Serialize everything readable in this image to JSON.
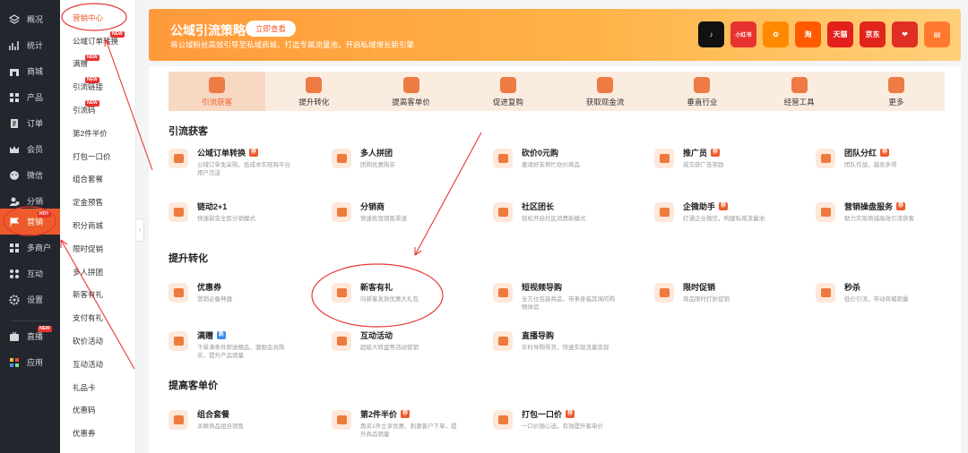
{
  "sidebar": {
    "items": [
      {
        "label": "概况",
        "icon": "layers-icon"
      },
      {
        "label": "统计",
        "icon": "chart-icon"
      },
      {
        "label": "商城",
        "icon": "store-icon"
      },
      {
        "label": "产品",
        "icon": "grid-icon"
      },
      {
        "label": "订单",
        "icon": "order-icon"
      },
      {
        "label": "会员",
        "icon": "crown-icon"
      },
      {
        "label": "微信",
        "icon": "wechat-icon"
      },
      {
        "label": "分销",
        "icon": "users-icon"
      },
      {
        "label": "营销",
        "icon": "flag-icon",
        "badge": "HOT"
      },
      {
        "label": "多商户",
        "icon": "shop-icon"
      },
      {
        "label": "互动",
        "icon": "apps-icon"
      },
      {
        "label": "设置",
        "icon": "gear-icon"
      },
      {
        "label": "直播",
        "icon": "tv-icon",
        "badge": "NEW"
      },
      {
        "label": "应用",
        "icon": "colorful-apps-icon"
      }
    ]
  },
  "subnav": {
    "items": [
      {
        "label": "营销中心"
      },
      {
        "label": "公域订单转换",
        "badge": "NEW"
      },
      {
        "label": "满赠",
        "badge": "NEW"
      },
      {
        "label": "引流链接",
        "badge": "NEW"
      },
      {
        "label": "引流码",
        "badge": "NEW"
      },
      {
        "label": "第2件半价"
      },
      {
        "label": "打包一口价"
      },
      {
        "label": "组合套餐"
      },
      {
        "label": "定金预售"
      },
      {
        "label": "积分商城"
      },
      {
        "label": "限时促销"
      },
      {
        "label": "多人拼团"
      },
      {
        "label": "新客有礼"
      },
      {
        "label": "支付有礼"
      },
      {
        "label": "砍价活动"
      },
      {
        "label": "互动活动"
      },
      {
        "label": "礼品卡"
      },
      {
        "label": "优惠码"
      },
      {
        "label": "优惠券"
      }
    ]
  },
  "banner": {
    "title": "公域引流策略",
    "button": "立即查看",
    "subtitle": "将公域粉丝高效引导至私域商城，打造专属流量池，开启私域增长新引擎",
    "platforms": [
      {
        "name": "抖音",
        "icon": "douyin-icon",
        "glyph": "♪",
        "color": "#111111"
      },
      {
        "name": "小红书",
        "icon": "xiaohongshu-icon",
        "glyph": "小红书",
        "color": "#e8322f"
      },
      {
        "name": "快手",
        "icon": "kuaishou-icon",
        "glyph": "✿",
        "color": "#ff8a00"
      },
      {
        "name": "淘宝",
        "icon": "taobao-icon",
        "glyph": "淘",
        "color": "#ff5a00"
      },
      {
        "name": "天猫",
        "icon": "tmall-icon",
        "glyph": "天猫",
        "color": "#e3201b"
      },
      {
        "name": "京东",
        "icon": "jd-icon",
        "glyph": "京东",
        "color": "#e1251b"
      },
      {
        "name": "拼多多",
        "icon": "pinduoduo-icon",
        "glyph": "❤",
        "color": "#e02e24"
      },
      {
        "name": "商城",
        "icon": "mall-icon",
        "glyph": "▤",
        "color": "#ff7a2e"
      }
    ]
  },
  "tabs": [
    {
      "label": "引流获客",
      "icon": "trend-icon"
    },
    {
      "label": "提升转化",
      "icon": "funnel-icon"
    },
    {
      "label": "提高客单价",
      "icon": "coin-icon"
    },
    {
      "label": "促进复购",
      "icon": "tag-icon"
    },
    {
      "label": "获取现金流",
      "icon": "wallet-icon"
    },
    {
      "label": "垂直行业",
      "icon": "document-icon"
    },
    {
      "label": "经营工具",
      "icon": "bag-icon"
    },
    {
      "label": "更多",
      "icon": "more-icon"
    }
  ],
  "sections": [
    {
      "title": "引流获客",
      "cards": [
        {
          "name": "公域订单转换",
          "tag": "荐",
          "desc": "公域订单免采购，低成本实现跨平台用户沉淀"
        },
        {
          "name": "多人拼团",
          "desc": "团购优惠购买"
        },
        {
          "name": "砍价0元购",
          "desc": "邀请好友帮忙砍价商品"
        },
        {
          "name": "推广员",
          "tag": "荐",
          "desc": "成交获广告奖励"
        },
        {
          "name": "团队分红",
          "tag": "荐",
          "desc": "团队作战，越卖多得"
        },
        {
          "name": "链动2+1",
          "desc": "快速裂变全民分销模式"
        },
        {
          "name": "分销商",
          "desc": "快速拓宽销售渠道"
        },
        {
          "name": "社区团长",
          "desc": "轻松开启社区消费新模式"
        },
        {
          "name": "企微助手",
          "tag": "荐",
          "desc": "打通企业微信，构建私域流量池"
        },
        {
          "name": "营销操盘服务",
          "tag": "荐",
          "desc": "助力实现商城高效引流获客"
        }
      ]
    },
    {
      "title": "提升转化",
      "cards": [
        {
          "name": "优惠券",
          "desc": "营销必备神器"
        },
        {
          "name": "新客有礼",
          "desc": "向新客发放优惠大礼包"
        },
        {
          "name": "短视频导购",
          "desc": "全方位包装商品，带来身临其境的购物体验"
        },
        {
          "name": "限时促销",
          "desc": "商品限时打折促销"
        },
        {
          "name": "秒杀",
          "desc": "低价引流，带动商城销量"
        },
        {
          "name": "满赠",
          "tagb": "新",
          "desc": "下单满条件即送赠品，激励会员购买，提升产品销量"
        },
        {
          "name": "互动活动",
          "desc": "超级大转盘等活动营销"
        },
        {
          "name": "直播导购",
          "desc": "实时导购带货，快速实现流量变现"
        }
      ]
    },
    {
      "title": "提高客单价",
      "cards": [
        {
          "name": "组合套餐",
          "desc": "关联商品组合销售"
        },
        {
          "name": "第2件半价",
          "tag": "荐",
          "desc": "再买1件立享优惠，刺激客户下单，提升商品销量"
        },
        {
          "name": "打包一口价",
          "tag": "荐",
          "desc": "一口价随心选，有效提升客单价"
        }
      ]
    }
  ]
}
